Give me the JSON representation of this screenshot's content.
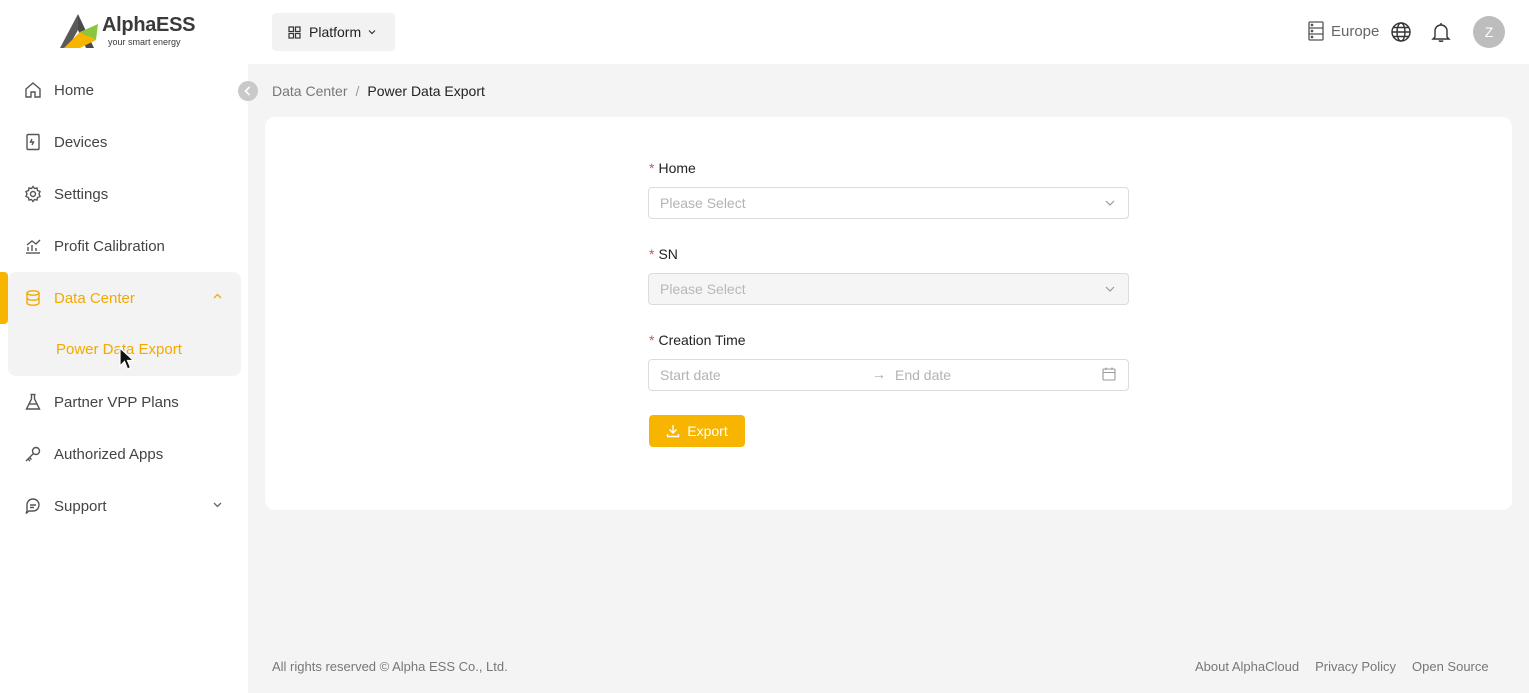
{
  "brand": {
    "name": "AlphaESS",
    "tagline": "your smart energy",
    "accent_color": "#f7b500"
  },
  "sidebar": {
    "collapse_icon": "chevron-left-icon",
    "items": [
      {
        "label": "Home",
        "icon": "home-icon"
      },
      {
        "label": "Devices",
        "icon": "device-icon"
      },
      {
        "label": "Settings",
        "icon": "gear-icon"
      },
      {
        "label": "Profit Calibration",
        "icon": "chart-icon"
      },
      {
        "label": "Data Center",
        "icon": "database-icon",
        "expanded": true,
        "active": true
      },
      {
        "label": "Partner VPP Plans",
        "icon": "flask-icon"
      },
      {
        "label": "Authorized Apps",
        "icon": "key-icon"
      },
      {
        "label": "Support",
        "icon": "support-icon",
        "expanded": false
      }
    ],
    "sub_items": [
      {
        "label": "Power Data Export",
        "active": true
      }
    ]
  },
  "topbar": {
    "platform_label": "Platform",
    "region_label": "Europe",
    "avatar_initial": "Z"
  },
  "breadcrumb": {
    "parent": "Data Center",
    "separator": "/",
    "current": "Power Data Export"
  },
  "form": {
    "home": {
      "label": "Home",
      "required": true,
      "placeholder": "Please Select"
    },
    "sn": {
      "label": "SN",
      "required": true,
      "placeholder": "Please Select",
      "disabled": true
    },
    "creation_time": {
      "label": "Creation Time",
      "required": true,
      "start_placeholder": "Start date",
      "end_placeholder": "End date"
    },
    "required_mark": "*",
    "export_label": "Export"
  },
  "footer": {
    "copyright": "All rights reserved © Alpha ESS Co., Ltd.",
    "links": [
      "About AlphaCloud",
      "Privacy Policy",
      "Open Source"
    ]
  }
}
